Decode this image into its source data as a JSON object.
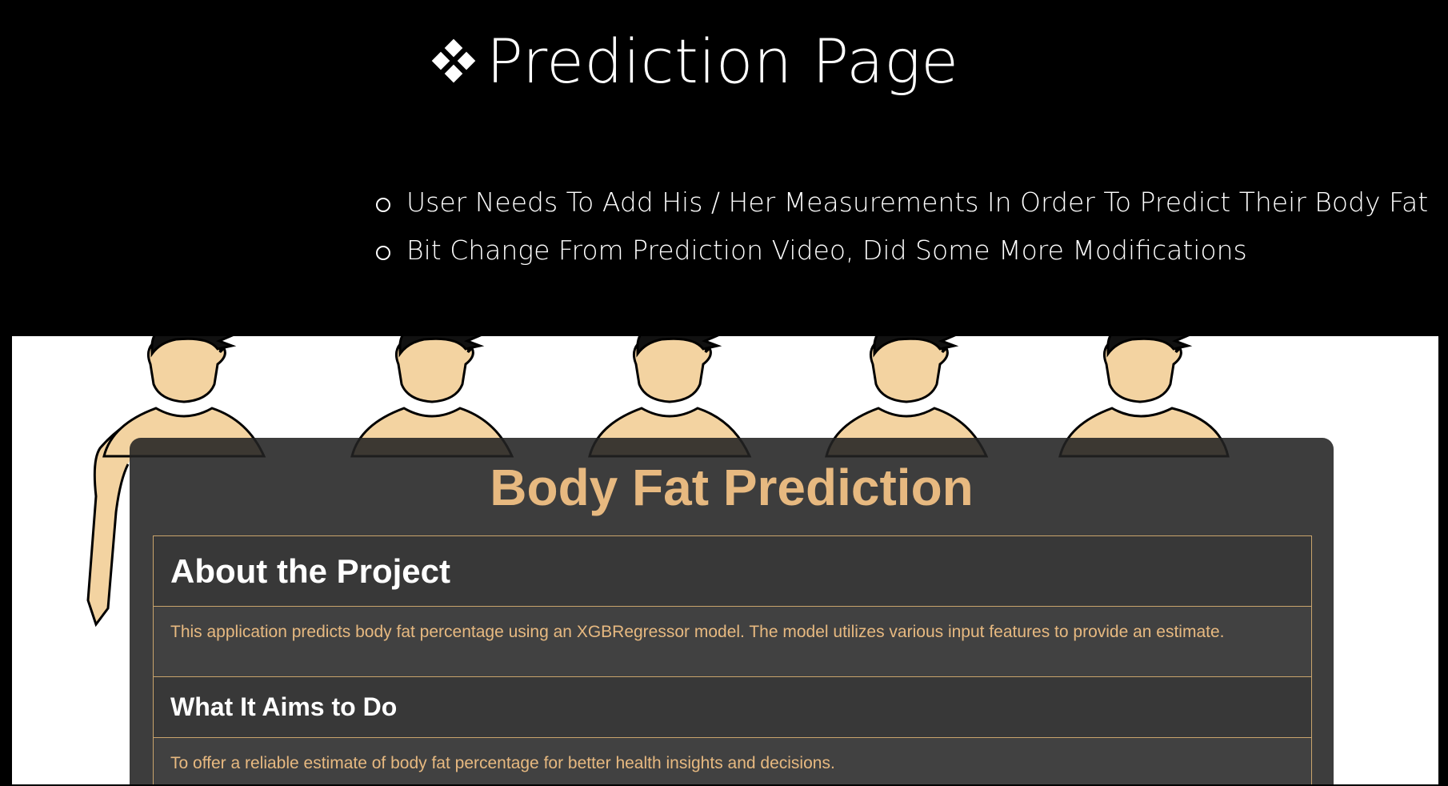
{
  "slide": {
    "title": "Prediction Page",
    "title_icon": "diamond-cluster-icon",
    "bullets": [
      "User Needs To Add His / Her Measurements In Order To Predict Their Body Fat",
      "Bit Change From Prediction Video, Did Some More Modifications"
    ]
  },
  "app": {
    "title": "Body Fat Prediction",
    "title_color": "#e7b980",
    "sections": [
      {
        "heading": "About the Project",
        "body": "This application predicts body fat percentage using an XGBRegressor model. The model utilizes various input features to provide an estimate."
      },
      {
        "heading": "What It Aims to Do",
        "body": "To offer a reliable estimate of body fat percentage for better health insights and decisions."
      }
    ]
  },
  "colors": {
    "background": "#000000",
    "accent": "#e7b980",
    "card": "#222222"
  }
}
